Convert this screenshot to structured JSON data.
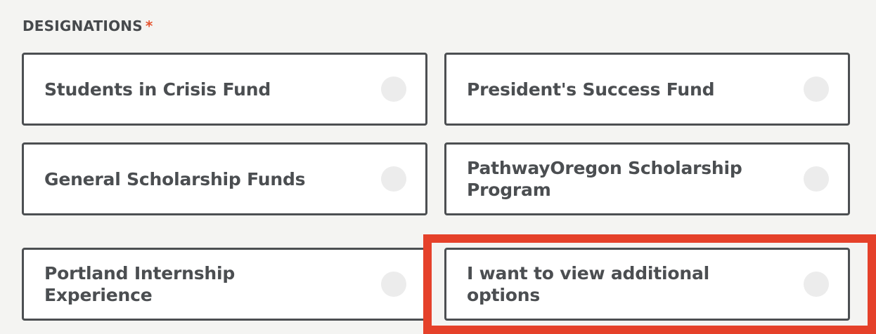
{
  "section": {
    "label": "DESIGNATIONS",
    "required_marker": "*"
  },
  "options": [
    {
      "label": "Students in Crisis Fund",
      "selected": false
    },
    {
      "label": "President's Success Fund",
      "selected": false
    },
    {
      "label": "General Scholarship Funds",
      "selected": false
    },
    {
      "label": "PathwayOregon Scholarship Program",
      "selected": false
    },
    {
      "label": "Portland Internship Experience",
      "selected": false
    },
    {
      "label": "I want to view additional options",
      "selected": false,
      "highlighted": true
    }
  ],
  "colors": {
    "highlight": "#e5412a",
    "required": "#e5532f",
    "text": "#46494c",
    "radio": "#ececec"
  }
}
